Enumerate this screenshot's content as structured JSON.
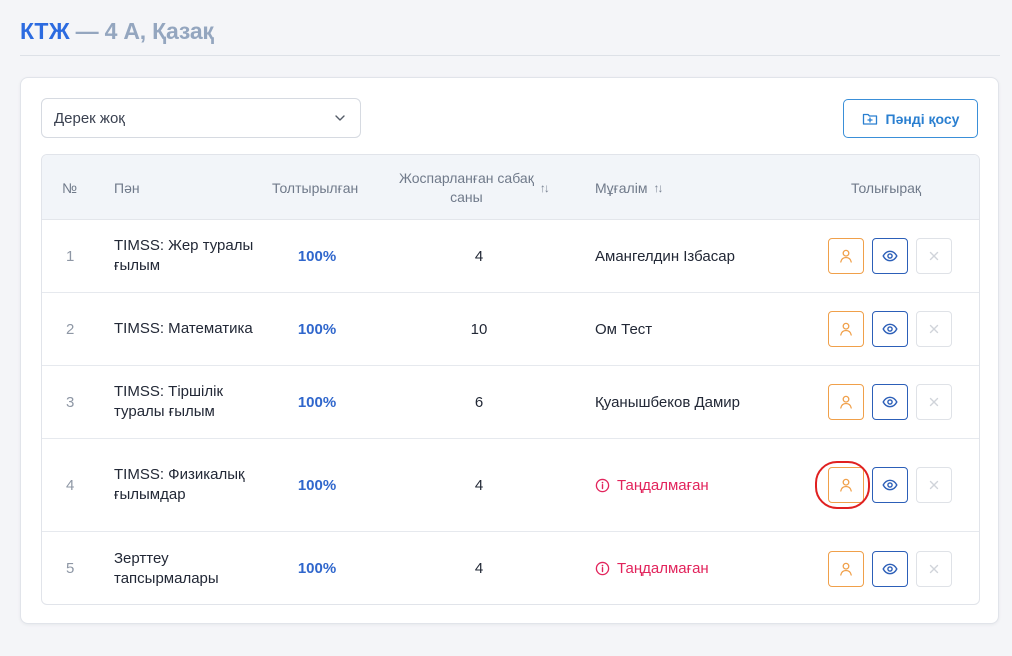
{
  "page": {
    "title_brand": "КТЖ",
    "title_rest": "— 4 А, Қазақ"
  },
  "toolbar": {
    "select_value": "Дерек жоқ",
    "add_subject_label": "Пәнді қосу"
  },
  "table": {
    "headers": {
      "number": "№",
      "subject": "Пән",
      "filled": "Толтырылған",
      "planned_line1": "Жоспарланған сабақ",
      "planned_line2": "саны",
      "teacher": "Мұғалім",
      "folder": "Толығырақ"
    },
    "rows": [
      {
        "num": "1",
        "subject": "TIMSS: Жер туралы ғылым",
        "filled": "100%",
        "count": "4",
        "teacher": "Амангелдин Ізбасар",
        "missing": false
      },
      {
        "num": "2",
        "subject": "TIMSS: Математика",
        "filled": "100%",
        "count": "10",
        "teacher": "Ом Тест",
        "missing": false
      },
      {
        "num": "3",
        "subject": "TIMSS: Тіршілік туралы ғылым",
        "filled": "100%",
        "count": "6",
        "teacher": "Қуанышбеков Дамир",
        "missing": false
      },
      {
        "num": "4",
        "subject": "TIMSS: Физикалық ғылымдар",
        "filled": "100%",
        "count": "4",
        "teacher": "Таңдалмаған",
        "missing": true
      },
      {
        "num": "5",
        "subject": "Зерттеу тапсырмалары",
        "filled": "100%",
        "count": "4",
        "teacher": "Таңдалмаған",
        "missing": true
      }
    ]
  },
  "colors": {
    "brand": "#2c6be0",
    "accent_orange": "#f0a04a",
    "view_blue": "#2c5fb8",
    "missing_red": "#e2245c"
  },
  "icons": {
    "assign": "user-icon",
    "view": "eye-icon",
    "delete": "close-icon",
    "add": "folder-plus-icon",
    "warning": "info-circle-icon"
  }
}
